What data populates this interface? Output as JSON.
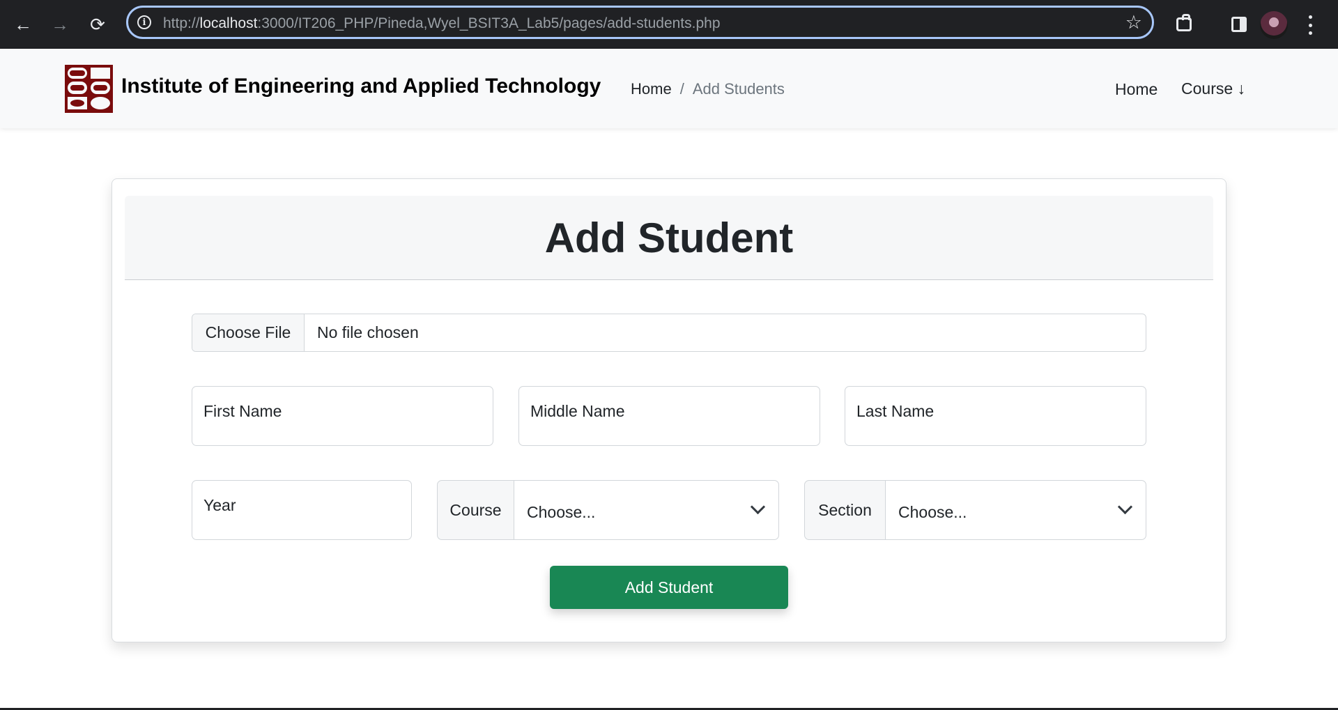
{
  "browser": {
    "url_prefix": "http://",
    "url_host": "localhost",
    "url_rest": ":3000/IT206_PHP/Pineda,Wyel_BSIT3A_Lab5/pages/add-students.php"
  },
  "navbar": {
    "brand": "Institute of Engineering and Applied Technology",
    "breadcrumb": {
      "home": "Home",
      "separator": "/",
      "current": "Add Students"
    },
    "links": {
      "home": "Home",
      "course": "Course ↓"
    },
    "logo_color": "#7a0c0c"
  },
  "form": {
    "title": "Add Student",
    "file": {
      "button": "Choose File",
      "status": "No file chosen"
    },
    "first_name_placeholder": "First Name",
    "middle_name_placeholder": "Middle Name",
    "last_name_placeholder": "Last Name",
    "year_placeholder": "Year",
    "course": {
      "label": "Course",
      "selected": "Choose..."
    },
    "section": {
      "label": "Section",
      "selected": "Choose..."
    },
    "submit_label": "Add Student",
    "submit_color": "#198754"
  }
}
